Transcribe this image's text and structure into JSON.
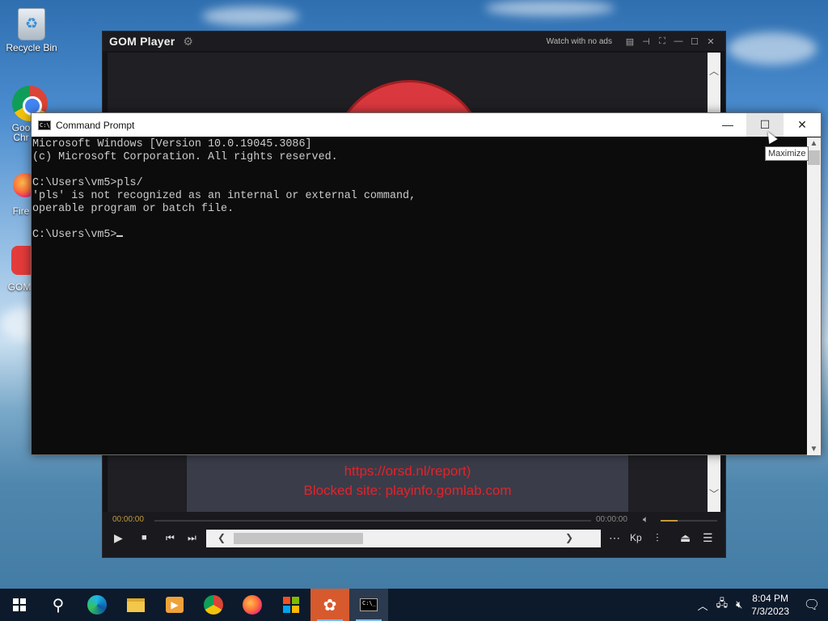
{
  "desktop": {
    "icons": [
      {
        "label": "Recycle Bin"
      },
      {
        "label": "Goo\nChr"
      },
      {
        "label": "Fire"
      },
      {
        "label": "GOM"
      }
    ]
  },
  "gom_player": {
    "logo": "GOM Player",
    "ads_label": "Watch with no ads",
    "messages": [
      "https://orsd.nl/report)",
      "Blocked site: playinfo.gomlab.com"
    ],
    "time_current": "00:00:00",
    "time_total": "00:00:00",
    "volume_level": 0.3
  },
  "cmd": {
    "title": "Command Prompt",
    "lines": [
      "Microsoft Windows [Version 10.0.19045.3086]",
      "(c) Microsoft Corporation. All rights reserved.",
      "",
      "C:\\Users\\vm5>pls/",
      "'pls' is not recognized as an internal or external command,",
      "operable program or batch file.",
      "",
      "C:\\Users\\vm5>"
    ],
    "tooltip": "Maximize"
  },
  "taskbar": {
    "items": [
      {
        "name": "start-button",
        "icon": "windows-icon"
      },
      {
        "name": "search-button",
        "icon": "search-icon"
      },
      {
        "name": "edge",
        "icon": "edge-icon"
      },
      {
        "name": "file-explorer",
        "icon": "folder-icon"
      },
      {
        "name": "media-player",
        "icon": "media-icon"
      },
      {
        "name": "chrome",
        "icon": "chrome-icon"
      },
      {
        "name": "firefox",
        "icon": "firefox-icon"
      },
      {
        "name": "store",
        "icon": "store-icon"
      },
      {
        "name": "gom",
        "icon": "gom-icon"
      },
      {
        "name": "cmd",
        "icon": "cmd-icon"
      }
    ],
    "clock_time": "8:04 PM",
    "clock_date": "7/3/2023"
  }
}
